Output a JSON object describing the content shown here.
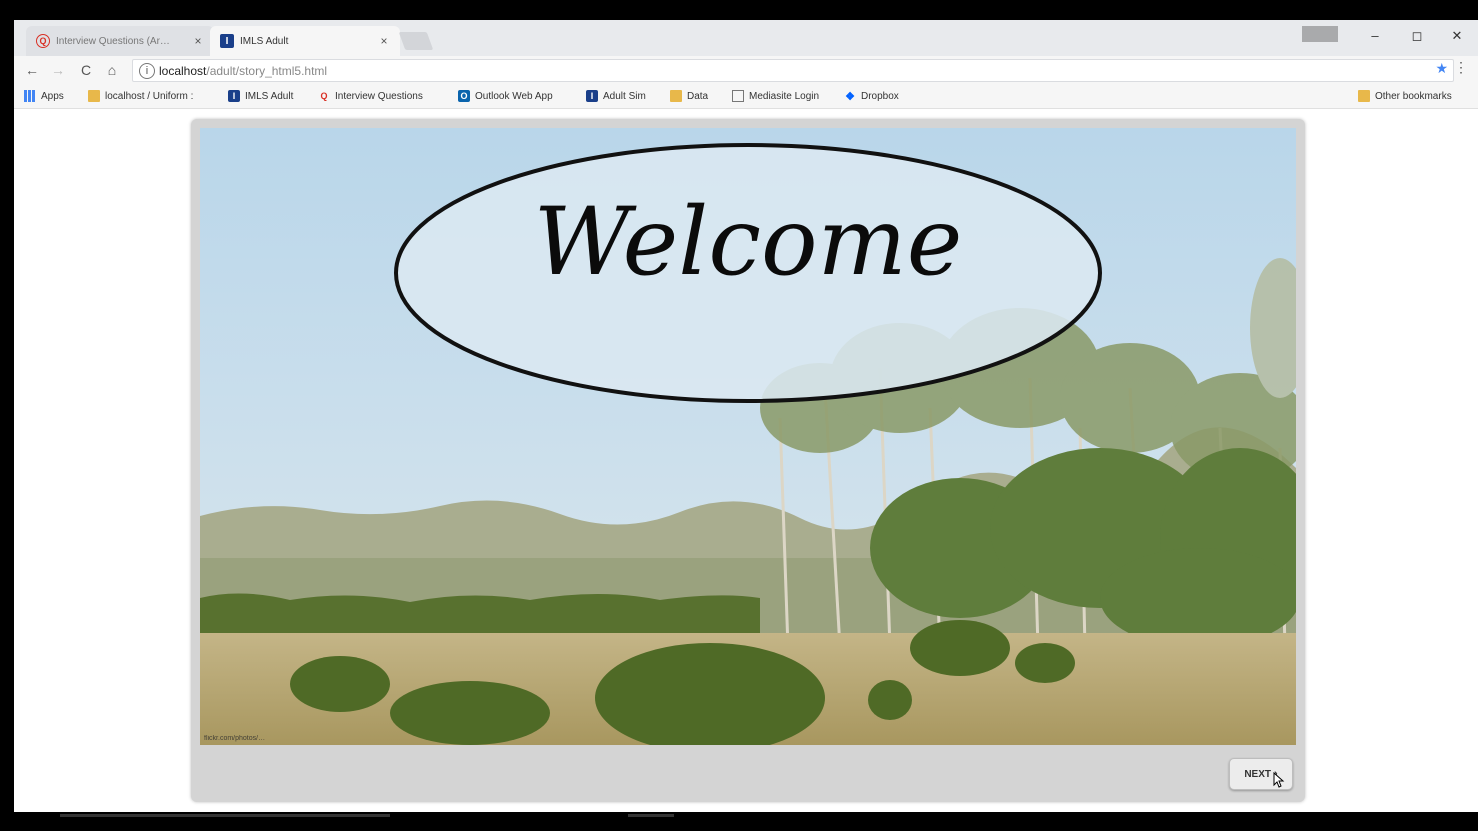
{
  "browser": {
    "tabs": [
      {
        "title": "Interview Questions (Ar…",
        "icon": "q-icon",
        "active": false
      },
      {
        "title": "IMLS Adult",
        "icon": "imls-icon",
        "active": true
      }
    ],
    "tab_close_glyph": "×",
    "window_controls": {
      "minimize": "–",
      "maximize": "◻",
      "close": "✕"
    },
    "nav": {
      "back": "←",
      "forward": "→",
      "reload": "C",
      "home": "⌂"
    },
    "url": {
      "host": "localhost",
      "path": "/adult/story_html5.html"
    },
    "bookmarks": [
      {
        "label": "Apps",
        "icon": "apps-icon"
      },
      {
        "label": "localhost / Uniform :",
        "icon": "folder-icon"
      },
      {
        "label": "IMLS Adult",
        "icon": "imls-icon"
      },
      {
        "label": "Interview Questions",
        "icon": "q-icon"
      },
      {
        "label": "Outlook Web App",
        "icon": "outlook-icon"
      },
      {
        "label": "Adult Sim",
        "icon": "imls-icon"
      },
      {
        "label": "Data",
        "icon": "folder-icon"
      },
      {
        "label": "Mediasite Login",
        "icon": "page-icon"
      },
      {
        "label": "Dropbox",
        "icon": "dropbox-icon"
      }
    ],
    "other_bookmarks": "Other bookmarks"
  },
  "slide": {
    "heading": "Welcome",
    "photo_credit": "flickr.com/photos/…",
    "next_label": "NEXT"
  },
  "colors": {
    "sky_top": "#b9d6ea",
    "sky_bottom": "#d9e7ee",
    "grass": "#b8a878",
    "tree_green": "#5f7d3c",
    "stage_gray": "#d4d4d4"
  }
}
